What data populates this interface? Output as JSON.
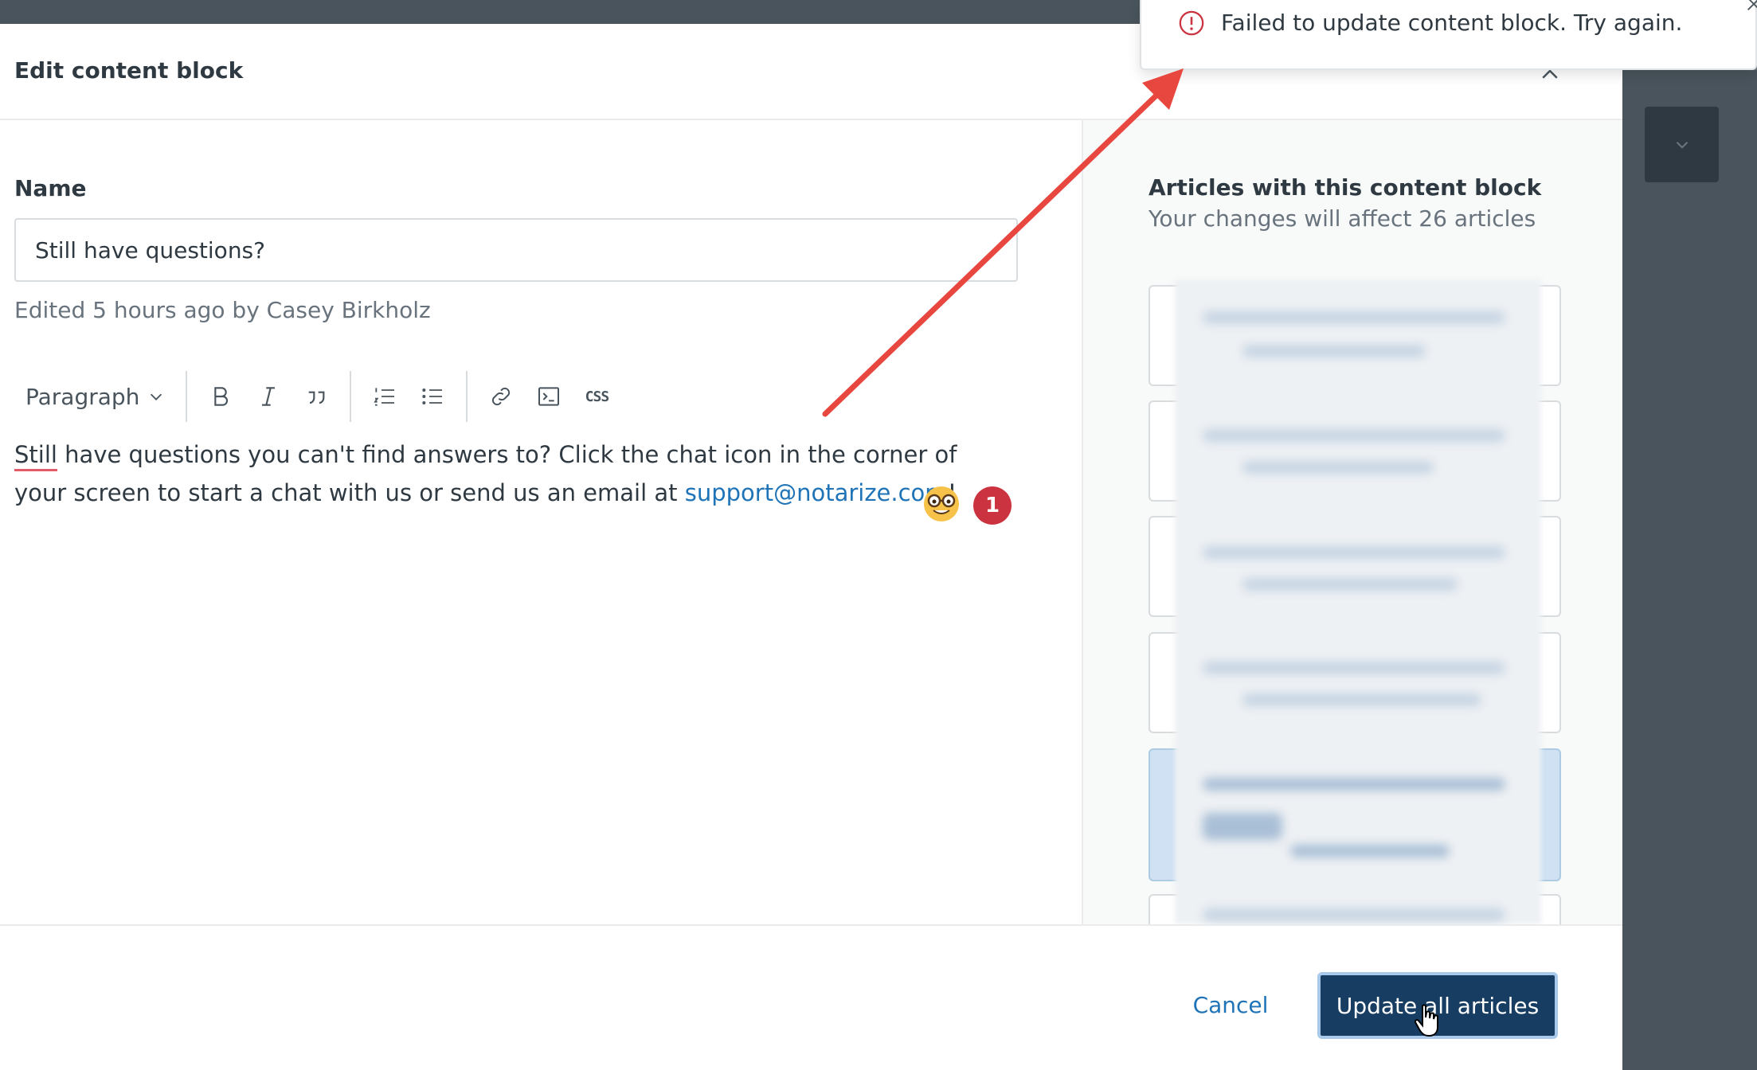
{
  "modal": {
    "title": "Edit content block"
  },
  "name_field": {
    "label": "Name",
    "value": "Still have questions?",
    "edited_note": "Edited 5 hours ago by Casey Birkholz"
  },
  "toolbar": {
    "paragraph_label": "Paragraph",
    "css_label": "CSS"
  },
  "editor": {
    "word_spellcheck": "Still",
    "text_part1": " have questions you can't find answers to? Click the chat icon in the corner of your screen to start a chat with us or send us an email at ",
    "link_text": "support@notarize.com",
    "text_end": "!",
    "badge_count": "1"
  },
  "articles": {
    "title": "Articles with this content block",
    "subtitle": "Your changes will affect 26 articles"
  },
  "footer": {
    "cancel_label": "Cancel",
    "update_label": "Update all articles"
  },
  "toast": {
    "message": "Failed to update content block. Try again."
  },
  "colors": {
    "primary": "#173e62",
    "link": "#1f73b7",
    "danger": "#cc3340",
    "annotation_arrow": "#e8473f"
  }
}
